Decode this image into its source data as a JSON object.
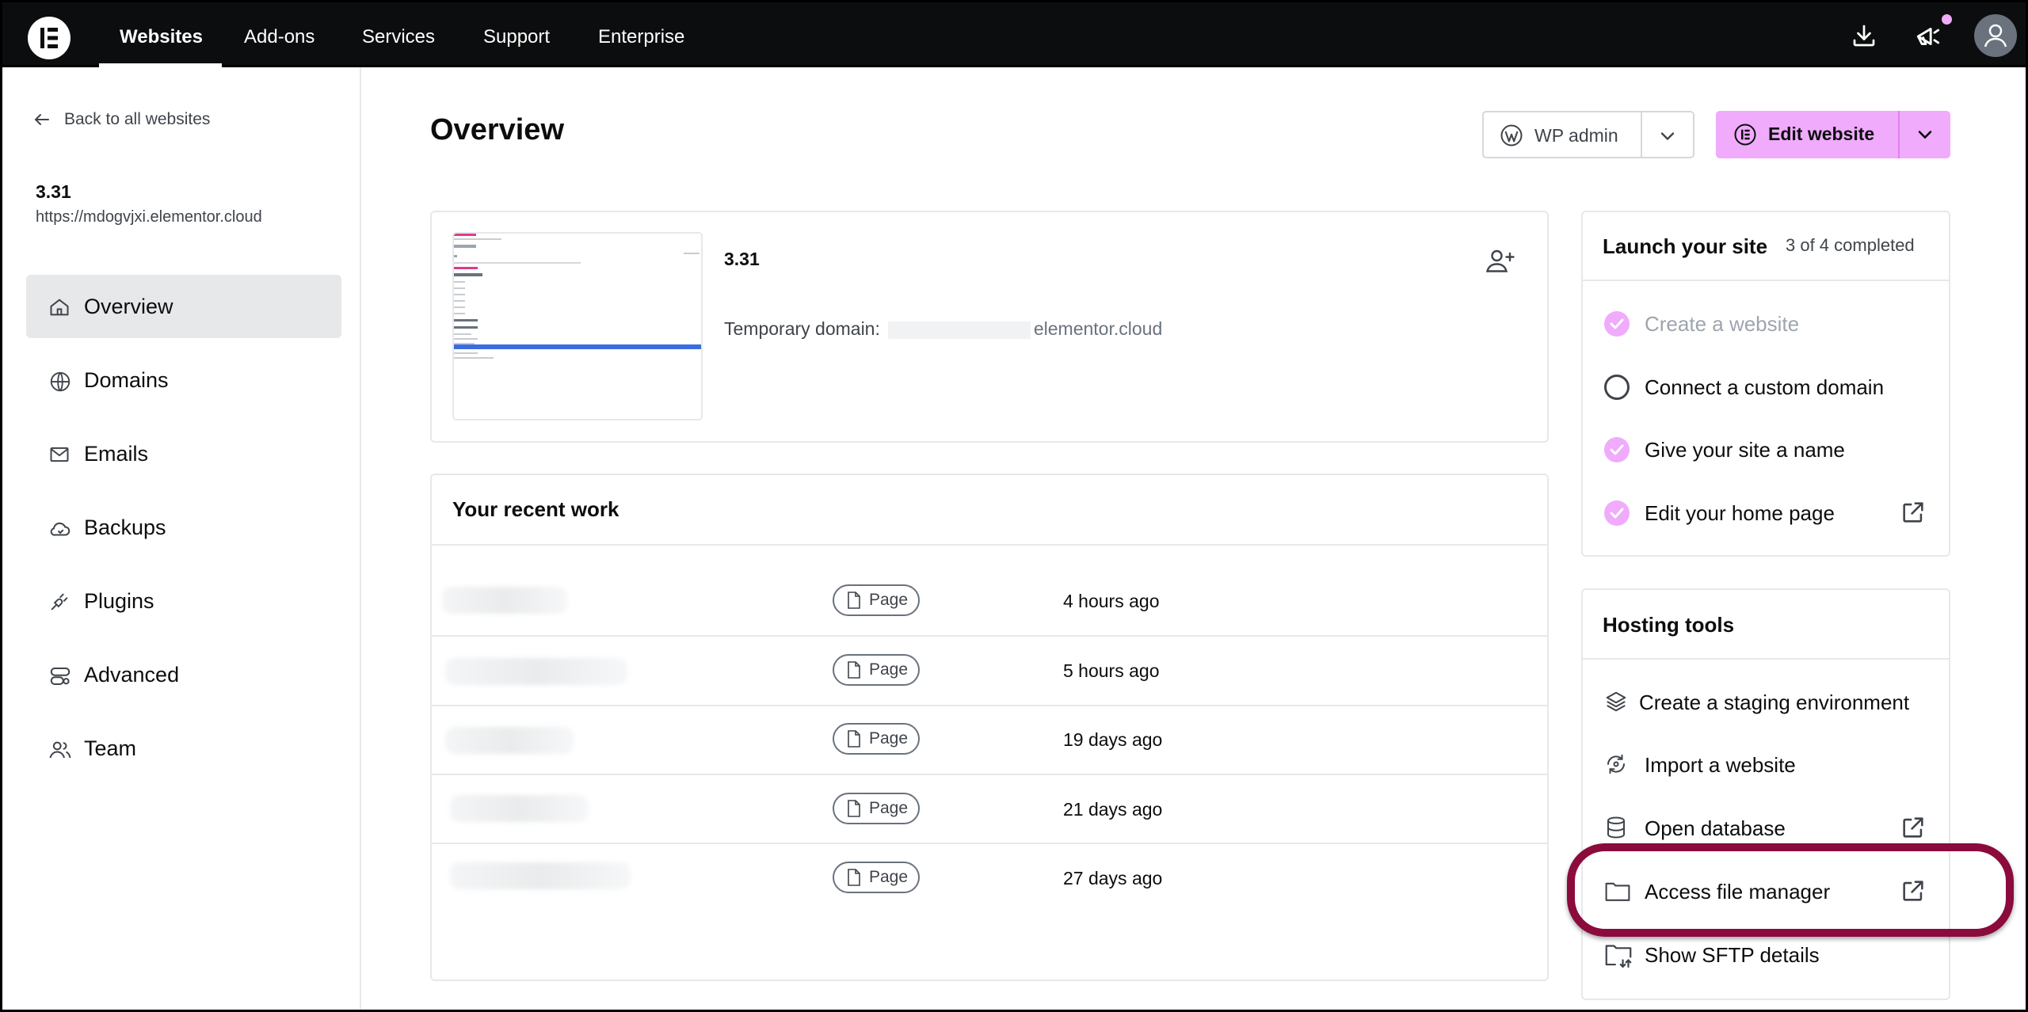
{
  "nav": {
    "items": [
      "Websites",
      "Add-ons",
      "Services",
      "Support",
      "Enterprise"
    ],
    "active": "Websites"
  },
  "sidebar": {
    "back_label": "Back to all websites",
    "site_name": "3.31",
    "site_url": "https://mdogvjxi.elementor.cloud",
    "items": [
      {
        "label": "Overview",
        "icon": "home-icon"
      },
      {
        "label": "Domains",
        "icon": "www-icon"
      },
      {
        "label": "Emails",
        "icon": "mail-icon"
      },
      {
        "label": "Backups",
        "icon": "cloud-icon"
      },
      {
        "label": "Plugins",
        "icon": "plug-icon"
      },
      {
        "label": "Advanced",
        "icon": "settings-toggle-icon"
      },
      {
        "label": "Team",
        "icon": "users-icon"
      }
    ]
  },
  "header": {
    "title": "Overview",
    "wp_admin_label": "WP admin",
    "edit_label": "Edit website"
  },
  "site_card": {
    "title": "3.31",
    "temp_domain_label": "Temporary domain:",
    "temp_domain_value": "elementor.cloud"
  },
  "recent": {
    "title": "Your recent work",
    "rows": [
      {
        "type": "Page",
        "when": "4 hours ago"
      },
      {
        "type": "Page",
        "when": "5 hours ago"
      },
      {
        "type": "Page",
        "when": "19 days ago"
      },
      {
        "type": "Page",
        "when": "21 days ago"
      },
      {
        "type": "Page",
        "when": "27 days ago"
      }
    ]
  },
  "launch": {
    "title": "Launch your site",
    "progress": "3 of 4 completed",
    "tasks": [
      {
        "label": "Create a website",
        "done": true
      },
      {
        "label": "Connect a custom domain",
        "done": false
      },
      {
        "label": "Give your site a name",
        "done": true
      },
      {
        "label": "Edit your home page",
        "done": true
      }
    ]
  },
  "hosting": {
    "title": "Hosting tools",
    "tools": [
      {
        "label": "Create a staging environment",
        "icon": "layers-icon"
      },
      {
        "label": "Import a website",
        "icon": "import-icon"
      },
      {
        "label": "Open database",
        "icon": "database-icon"
      },
      {
        "label": "Access file manager",
        "icon": "folder-icon"
      },
      {
        "label": "Show SFTP details",
        "icon": "folder-sync-icon"
      }
    ]
  },
  "colors": {
    "accent": "#f0abfc",
    "highlight": "#8a0b3c",
    "topbar": "#0c0d0e"
  }
}
